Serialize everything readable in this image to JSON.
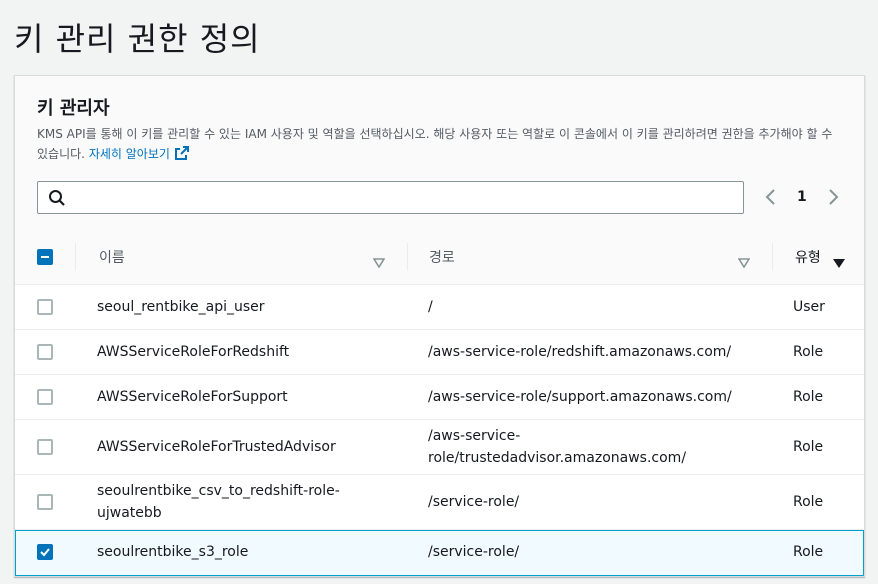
{
  "page": {
    "title": "키 관리 권한 정의"
  },
  "panel": {
    "title": "키 관리자",
    "description": "KMS API를 통해 이 키를 관리할 수 있는 IAM 사용자 및 역할을 선택하십시오. 해당 사용자 또는 역할로 이 콘솔에서 이 키를 관리하려면 권한을 추가해야 할 수 있습니다.",
    "learn_more": "자세히 알아보기"
  },
  "search": {
    "value": "",
    "placeholder": ""
  },
  "pagination": {
    "current_page": "1"
  },
  "table": {
    "headers": {
      "name": "이름",
      "path": "경로",
      "type": "유형"
    },
    "rows": [
      {
        "name": "seoul_rentbike_api_user",
        "path": "/",
        "type": "User",
        "checked": false
      },
      {
        "name": "AWSServiceRoleForRedshift",
        "path": "/aws-service-role/redshift.amazonaws.com/",
        "type": "Role",
        "checked": false
      },
      {
        "name": "AWSServiceRoleForSupport",
        "path": "/aws-service-role/support.amazonaws.com/",
        "type": "Role",
        "checked": false
      },
      {
        "name": "AWSServiceRoleForTrustedAdvisor",
        "path_line1": "/aws-service-",
        "path_line2": "role/trustedadvisor.amazonaws.com/",
        "type": "Role",
        "checked": false
      },
      {
        "name_line1": "seoulrentbike_csv_to_redshift-role-",
        "name_line2": "ujwatebb",
        "path": "/service-role/",
        "type": "Role",
        "checked": false
      },
      {
        "name": "seoulrentbike_s3_role",
        "path": "/service-role/",
        "type": "Role",
        "checked": true
      }
    ]
  },
  "colors": {
    "accent": "#0073bb",
    "selected_border": "#00a1c9",
    "selected_bg": "#f1faff"
  }
}
